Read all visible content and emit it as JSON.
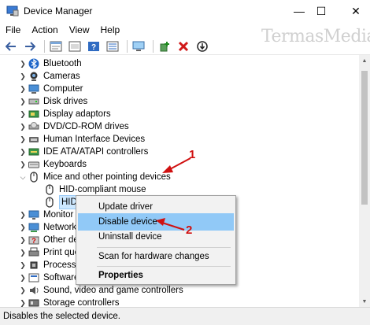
{
  "window": {
    "title": "Device Manager",
    "controls": {
      "minimize": "—",
      "maximize": "☐",
      "close": "✕"
    }
  },
  "menu": [
    "File",
    "Action",
    "View",
    "Help"
  ],
  "toolbar": {
    "icons": [
      "back-icon",
      "forward-icon",
      "properties-icon",
      "show-hidden-icon",
      "help-icon",
      "computer-icon",
      "update-driver-icon",
      "uninstall-icon",
      "disable-icon"
    ]
  },
  "tree": [
    {
      "label": "Bluetooth",
      "icon": "bluetooth-icon",
      "expanded": false
    },
    {
      "label": "Cameras",
      "icon": "camera-icon",
      "expanded": false
    },
    {
      "label": "Computer",
      "icon": "computer-icon",
      "expanded": false
    },
    {
      "label": "Disk drives",
      "icon": "disk-icon",
      "expanded": false
    },
    {
      "label": "Display adaptors",
      "icon": "display-icon",
      "expanded": false
    },
    {
      "label": "DVD/CD-ROM drives",
      "icon": "dvd-icon",
      "expanded": false
    },
    {
      "label": "Human Interface Devices",
      "icon": "hid-icon",
      "expanded": false
    },
    {
      "label": "IDE ATA/ATAPI controllers",
      "icon": "ide-icon",
      "expanded": false
    },
    {
      "label": "Keyboards",
      "icon": "keyboard-icon",
      "expanded": false
    },
    {
      "label": "Mice and other pointing devices",
      "icon": "mouse-icon",
      "expanded": true
    },
    {
      "label": "HID-compliant mouse",
      "icon": "mouse-icon",
      "child": true
    },
    {
      "label": "HID-",
      "icon": "mouse-icon",
      "child": true,
      "selected": true
    },
    {
      "label": "Monitor",
      "icon": "monitor-icon",
      "expanded": false
    },
    {
      "label": "Network",
      "icon": "network-icon",
      "expanded": false
    },
    {
      "label": "Other de",
      "icon": "other-icon",
      "expanded": false
    },
    {
      "label": "Print que",
      "icon": "printer-icon",
      "expanded": false
    },
    {
      "label": "Processo",
      "icon": "processor-icon",
      "expanded": false
    },
    {
      "label": "Software",
      "icon": "software-icon",
      "expanded": false
    },
    {
      "label": "Sound, video and game controllers",
      "icon": "sound-icon",
      "expanded": false
    },
    {
      "label": "Storage controllers",
      "icon": "storage-icon",
      "expanded": false
    }
  ],
  "context_menu": {
    "items": [
      {
        "label": "Update driver"
      },
      {
        "label": "Disable device",
        "highlighted": true
      },
      {
        "label": "Uninstall device"
      },
      {
        "label": "Scan for hardware changes"
      },
      {
        "label": "Properties",
        "bold": true
      }
    ]
  },
  "annotations": {
    "one": "1",
    "two": "2"
  },
  "watermark": "TermasMedia",
  "status": "Disables the selected device.",
  "colors": {
    "highlight": "#91c9f7",
    "annotation": "#d01010",
    "accent": "#1a73c8"
  }
}
